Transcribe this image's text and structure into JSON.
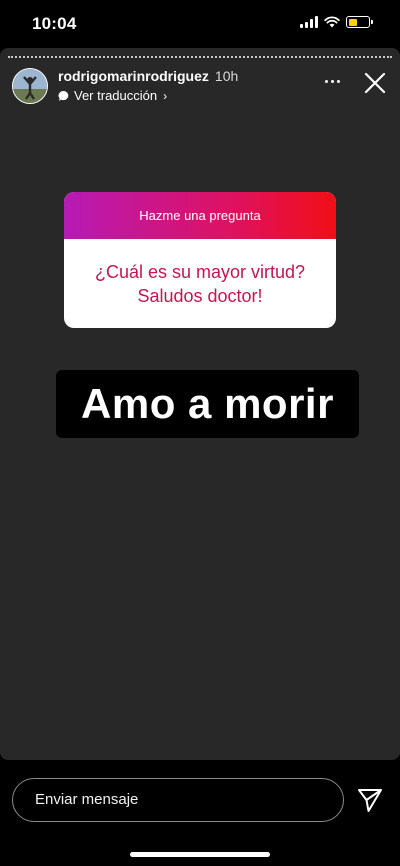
{
  "status_bar": {
    "time": "10:04",
    "battery_level": 0.45,
    "battery_color": "#f5d400"
  },
  "story": {
    "username": "rodrigomarinrodriguez",
    "time_ago": "10h",
    "translate_label": "Ver traducción",
    "question_sticker": {
      "header": "Hazme una pregunta",
      "question_line1": "¿Cuál es su mayor virtud?",
      "question_line2": "Saludos doctor!",
      "gradient_colors": [
        "#b61bb5",
        "#e0115b",
        "#f00f16"
      ],
      "question_color": "#c0174f"
    },
    "answer_text": "Amo a morir",
    "background_color": "#282828"
  },
  "footer": {
    "message_placeholder": "Enviar mensaje"
  },
  "icons": {
    "signal": "signal-icon",
    "wifi": "wifi-icon",
    "battery": "battery-icon",
    "translate": "speech-bubble-icon",
    "more": "more-horizontal-icon",
    "close": "close-icon",
    "send": "send-icon"
  }
}
